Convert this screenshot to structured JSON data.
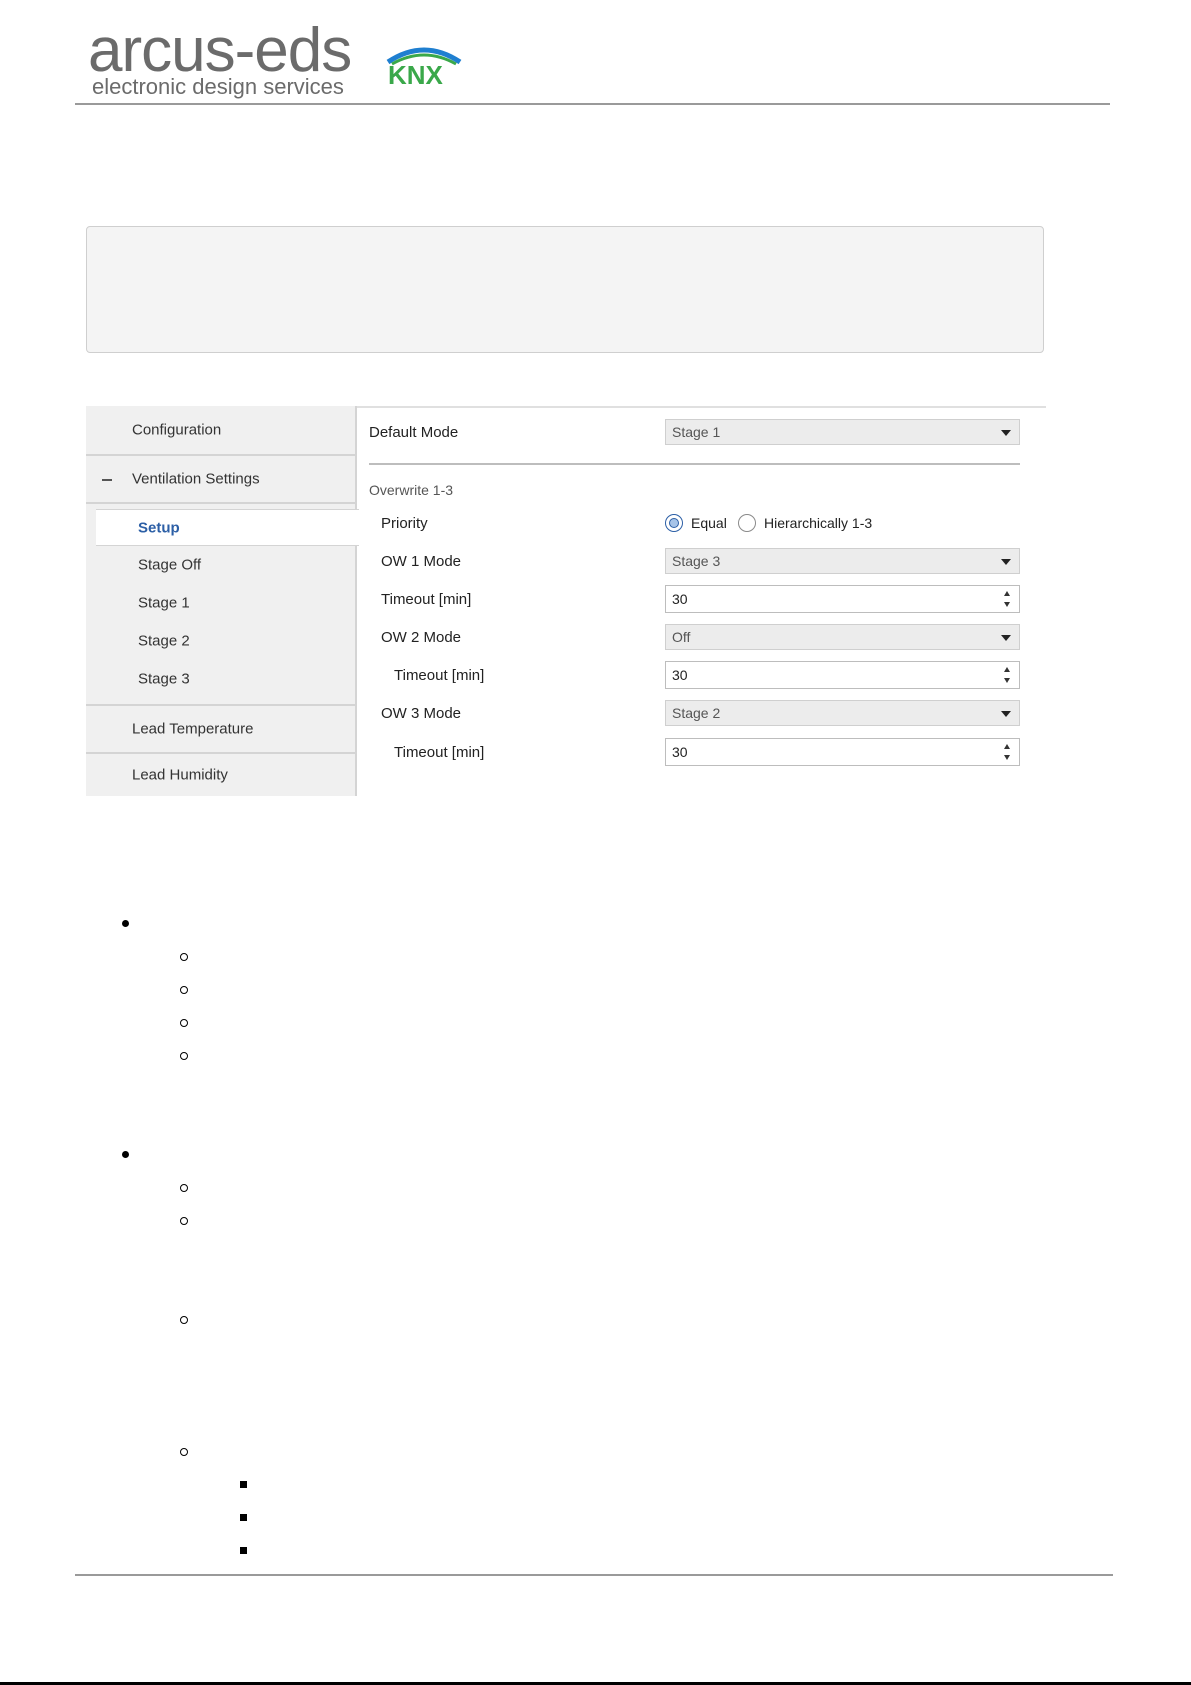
{
  "header": {
    "logo_main": "arcus-eds",
    "logo_sub": "electronic design services",
    "knx_logo": "KNX"
  },
  "sidebar": {
    "items": [
      {
        "label": "Configuration"
      },
      {
        "label": "Ventilation Settings",
        "icon": "minus-icon"
      },
      {
        "label": "Setup",
        "active": true
      },
      {
        "label": "Stage Off"
      },
      {
        "label": "Stage 1"
      },
      {
        "label": "Stage 2"
      },
      {
        "label": "Stage 3"
      },
      {
        "label": "Lead Temperature"
      },
      {
        "label": "Lead Humidity"
      }
    ]
  },
  "form": {
    "default_mode": {
      "label": "Default Mode",
      "value": "Stage 1"
    },
    "group_header": "Overwrite 1-3",
    "priority": {
      "label": "Priority",
      "options": [
        "Equal",
        "Hierarchically 1-3"
      ],
      "selected": "Equal"
    },
    "ow1_mode": {
      "label": "OW 1 Mode",
      "value": "Stage 3"
    },
    "ow1_timeout": {
      "label": "Timeout [min]",
      "value": "30"
    },
    "ow2_mode": {
      "label": "OW 2 Mode",
      "value": "Off"
    },
    "ow2_timeout": {
      "label": "Timeout [min]",
      "value": "30"
    },
    "ow3_mode": {
      "label": "OW 3 Mode",
      "value": "Stage 2"
    },
    "ow3_timeout": {
      "label": "Timeout [min]",
      "value": "30"
    }
  },
  "colors": {
    "active_link": "#2c5fa6",
    "sidebar_bg": "#f0f0f0",
    "rule": "#9a9a9a"
  }
}
